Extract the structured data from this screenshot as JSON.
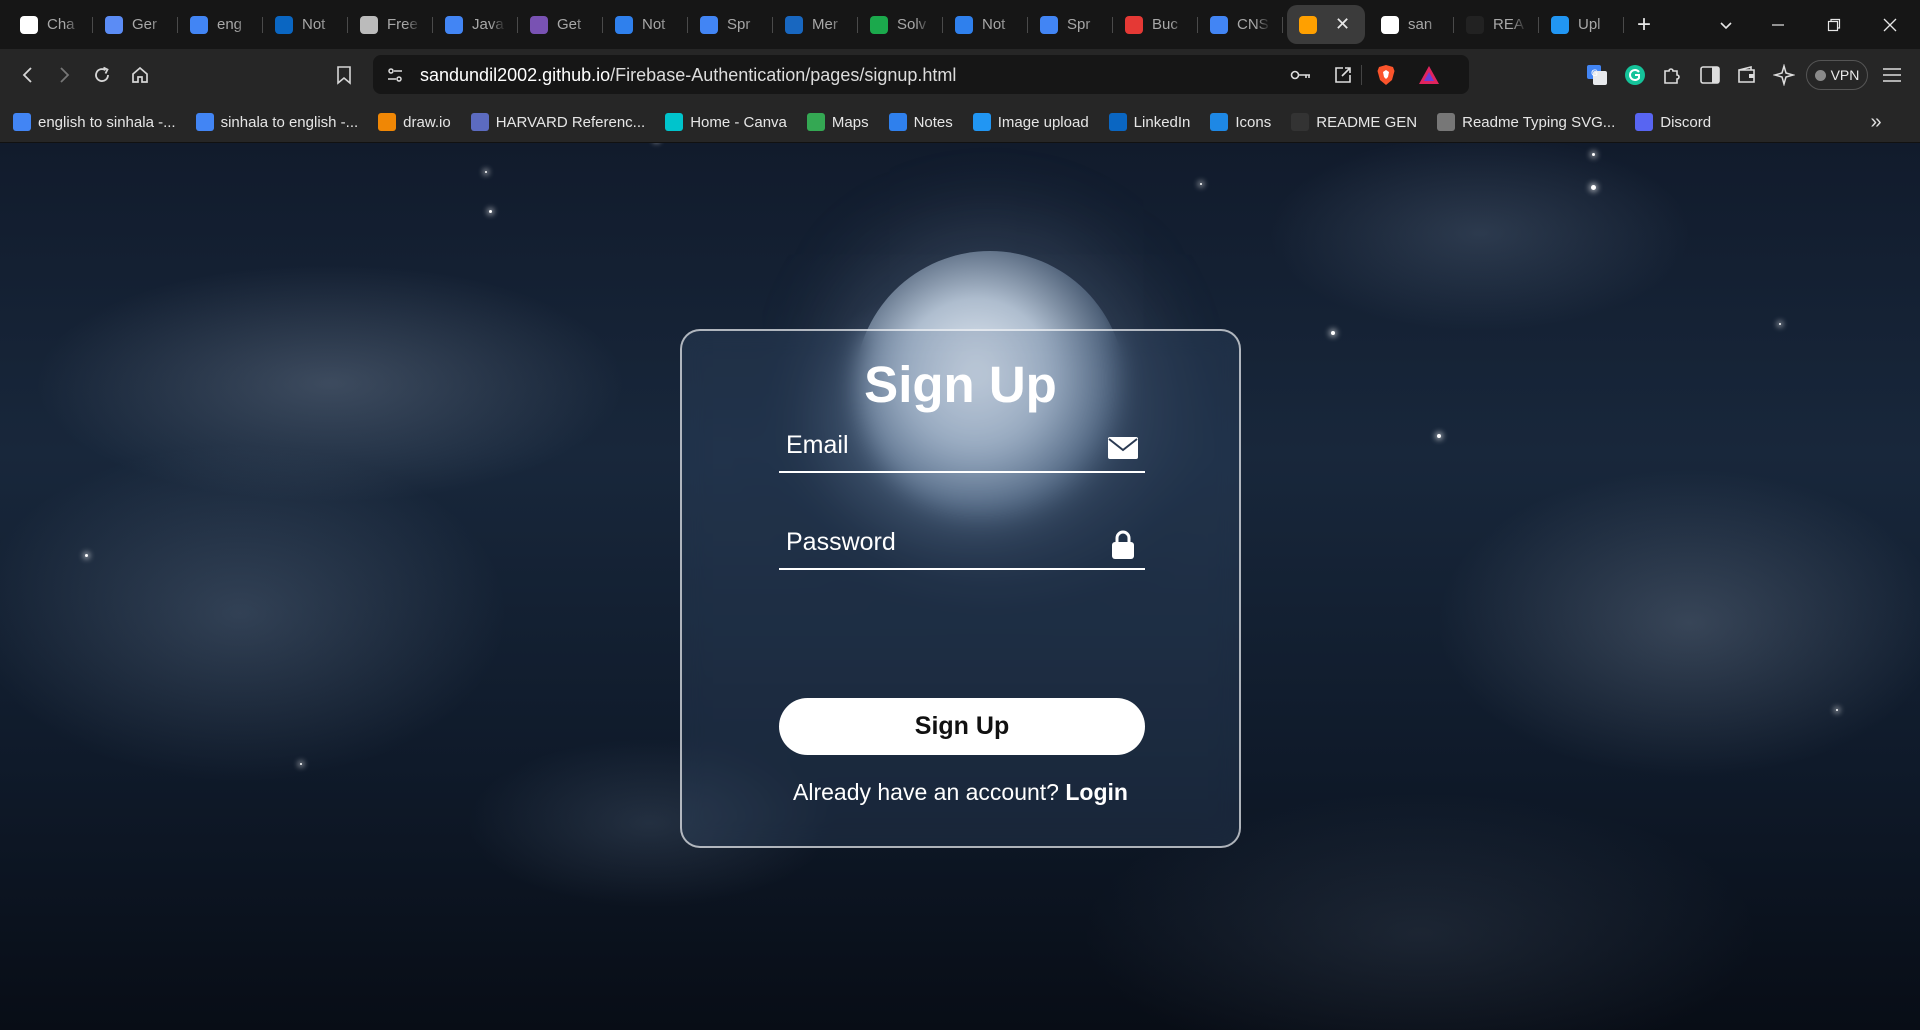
{
  "browser": {
    "tabs": [
      {
        "label": "Cha",
        "icon": "chatgpt-icon",
        "color": "#ffffff"
      },
      {
        "label": "Ger",
        "icon": "gemini-icon",
        "color": "#5b8cf5"
      },
      {
        "label": "eng",
        "icon": "google-icon",
        "color": "#4285f4"
      },
      {
        "label": "Not",
        "icon": "linkedin-icon",
        "color": "#0a66c2"
      },
      {
        "label": "Free",
        "icon": "freecodecamp-icon",
        "color": "#bbbbbb"
      },
      {
        "label": "Java",
        "icon": "google-icon",
        "color": "#4285f4"
      },
      {
        "label": "Get",
        "icon": "bootstrap-icon",
        "color": "#7952b3"
      },
      {
        "label": "Not",
        "icon": "notes-icon",
        "color": "#2f80ed"
      },
      {
        "label": "Spr",
        "icon": "google-docs-icon",
        "color": "#4285f4"
      },
      {
        "label": "Mer",
        "icon": "vuetify-icon",
        "color": "#1867c0"
      },
      {
        "label": "Solv",
        "icon": "hackerrank-icon",
        "color": "#1ba94c"
      },
      {
        "label": "Not",
        "icon": "notes-icon",
        "color": "#2f80ed"
      },
      {
        "label": "Spr",
        "icon": "google-docs-icon",
        "color": "#4285f4"
      },
      {
        "label": "Buc",
        "icon": "buddy-icon",
        "color": "#e53935"
      },
      {
        "label": "CNS",
        "icon": "google-docs-icon",
        "color": "#4285f4"
      },
      {
        "label": "",
        "icon": "firebase-icon",
        "color": "#ffa000",
        "active": true
      },
      {
        "label": "san",
        "icon": "github-icon",
        "color": "#ffffff"
      },
      {
        "label": "REA",
        "icon": "readme-icon",
        "color": "#222222"
      },
      {
        "label": "Upl",
        "icon": "imgbb-icon",
        "color": "#2196f3"
      }
    ],
    "url_host": "sandundil2002.github.io",
    "url_path": "/Firebase-Authentication/pages/signup.html",
    "vpn_label": "VPN",
    "bookmarks": [
      {
        "label": "english to sinhala -...",
        "icon": "google-icon",
        "color": "#4285f4"
      },
      {
        "label": "sinhala to english -...",
        "icon": "google-icon",
        "color": "#4285f4"
      },
      {
        "label": "draw.io",
        "icon": "drawio-icon",
        "color": "#f08705"
      },
      {
        "label": "HARVARD Referenc...",
        "icon": "document-icon",
        "color": "#5c6bc0"
      },
      {
        "label": "Home - Canva",
        "icon": "canva-icon",
        "color": "#00c4cc"
      },
      {
        "label": "Maps",
        "icon": "maps-icon",
        "color": "#34a853"
      },
      {
        "label": "Notes",
        "icon": "notes-icon",
        "color": "#2f80ed"
      },
      {
        "label": "Image upload",
        "icon": "imgbb-icon",
        "color": "#2196f3"
      },
      {
        "label": "LinkedIn",
        "icon": "linkedin-icon",
        "color": "#0a66c2"
      },
      {
        "label": "Icons",
        "icon": "search-icon",
        "color": "#1e88e5"
      },
      {
        "label": "README GEN",
        "icon": "readme-icon",
        "color": "#333333"
      },
      {
        "label": "Readme Typing SVG...",
        "icon": "keyboard-icon",
        "color": "#777777"
      },
      {
        "label": "Discord",
        "icon": "discord-icon",
        "color": "#5865f2"
      }
    ]
  },
  "page": {
    "title": "Sign Up",
    "email_placeholder": "Email",
    "password_placeholder": "Password",
    "submit_label": "Sign Up",
    "login_prompt": "Already have an account?",
    "login_link": "Login"
  }
}
